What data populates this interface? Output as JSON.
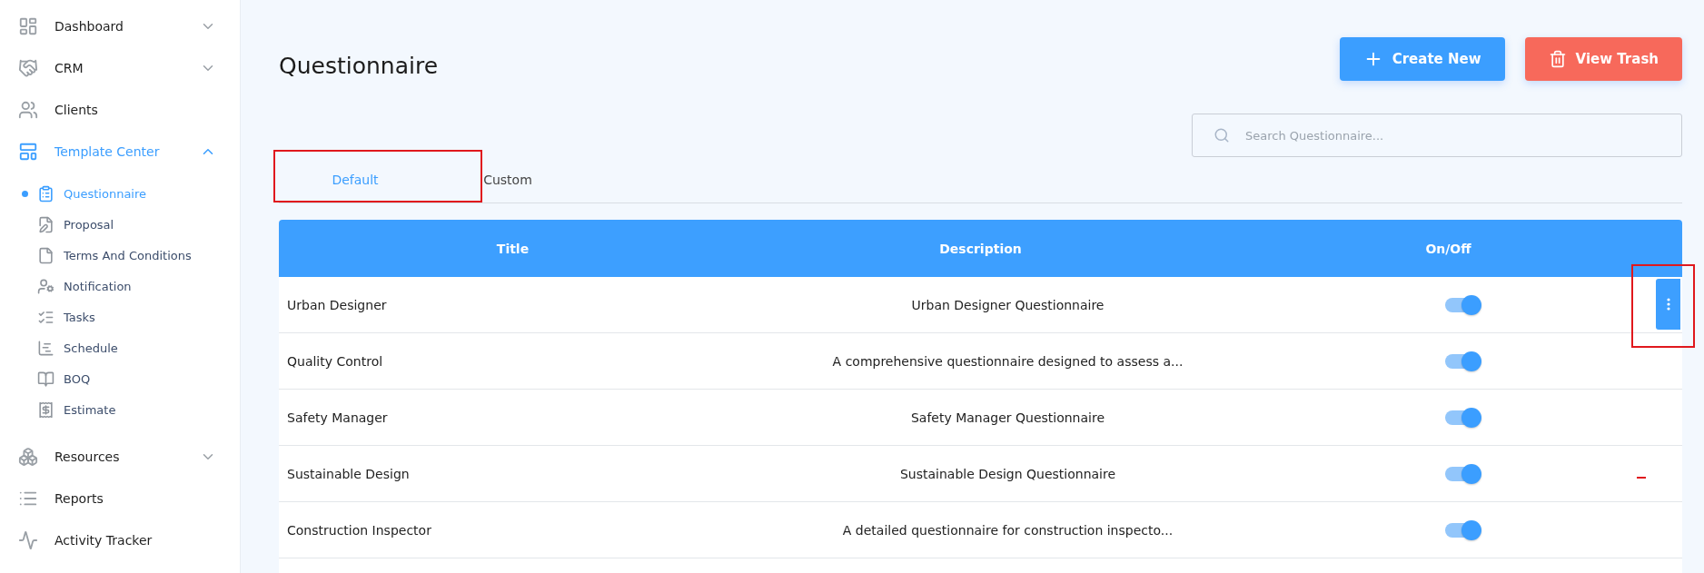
{
  "sidebar": {
    "items": [
      {
        "label": "Dashboard",
        "selected": false,
        "expanded": false
      },
      {
        "label": "CRM",
        "selected": false,
        "expanded": false
      },
      {
        "label": "Clients",
        "selected": false
      },
      {
        "label": "Template Center",
        "selected": true,
        "expanded": true,
        "children": [
          {
            "label": "Questionnaire",
            "selected": true
          },
          {
            "label": "Proposal",
            "selected": false
          },
          {
            "label": "Terms And Conditions",
            "selected": false
          },
          {
            "label": "Notification",
            "selected": false
          },
          {
            "label": "Tasks",
            "selected": false
          },
          {
            "label": "Schedule",
            "selected": false
          },
          {
            "label": "BOQ",
            "selected": false
          },
          {
            "label": "Estimate",
            "selected": false
          }
        ]
      },
      {
        "label": "Resources",
        "selected": false,
        "expanded": false
      },
      {
        "label": "Reports",
        "selected": false
      },
      {
        "label": "Activity Tracker",
        "selected": false
      }
    ]
  },
  "page": {
    "title": "Questionnaire",
    "buttons": [
      {
        "label": "Create New",
        "kind": "create"
      },
      {
        "label": "View Trash",
        "kind": "trash"
      }
    ],
    "search": {
      "placeholder": "Search Questionnaire..."
    },
    "tabs": [
      {
        "label": "Default",
        "selected": true,
        "highlighted": true
      },
      {
        "label": "Custom",
        "selected": false,
        "highlighted": false
      }
    ],
    "table": {
      "columns": [
        "Title",
        "Description",
        "On/Off"
      ],
      "rows": [
        {
          "title": "Urban Designer",
          "description": "Urban Designer Questionnaire",
          "on": true,
          "menu_open": true,
          "highlighted": true
        },
        {
          "title": "Quality Control",
          "description": "A comprehensive questionnaire designed to assess a...",
          "on": true,
          "menu_open": false,
          "highlighted": false
        },
        {
          "title": "Safety Manager",
          "description": "Safety Manager Questionnaire",
          "on": true,
          "menu_open": false,
          "highlighted": false
        },
        {
          "title": "Sustainable Design",
          "description": "Sustainable Design Questionnaire",
          "on": true,
          "menu_open": false,
          "highlighted": false
        },
        {
          "title": "Construction Inspector",
          "description": "A detailed questionnaire for construction inspecto...",
          "on": true,
          "menu_open": false,
          "highlighted": false
        }
      ]
    }
  }
}
